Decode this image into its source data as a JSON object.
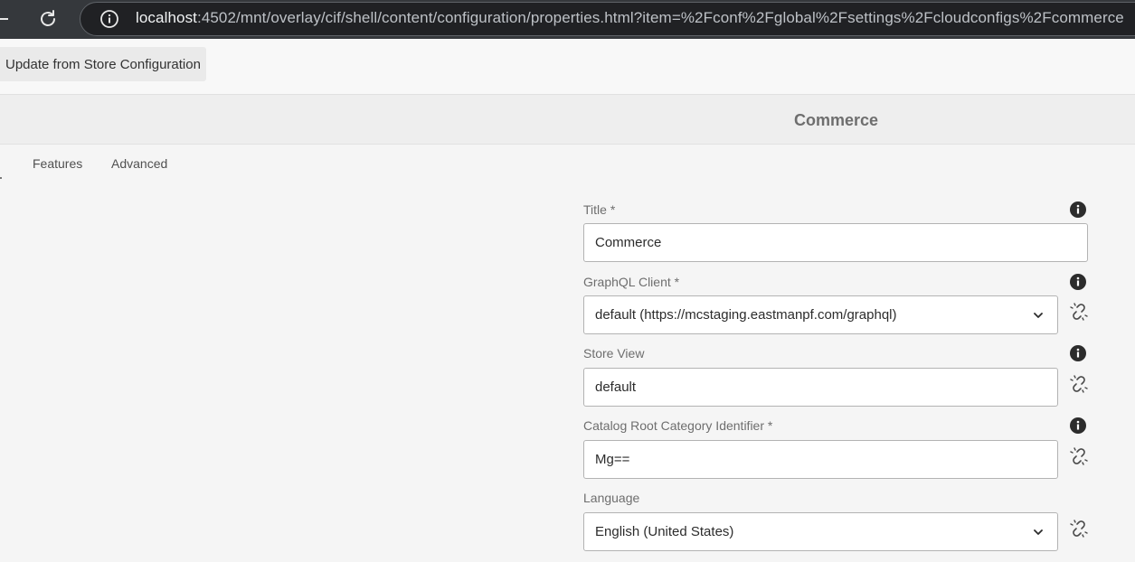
{
  "browser": {
    "url_host": "localhost",
    "url_path": ":4502/mnt/overlay/cif/shell/content/configuration/properties.html?item=%2Fconf%2Fglobal%2Fsettings%2Fcloudconfigs%2Fcommerce"
  },
  "toolbar": {
    "update_label": "Update from Store Configuration"
  },
  "header": {
    "title": "Commerce"
  },
  "tabs": [
    {
      "label": "Features"
    },
    {
      "label": "Advanced"
    }
  ],
  "form": {
    "title": {
      "label": "Title *",
      "value": "Commerce"
    },
    "graphql_client": {
      "label": "GraphQL Client *",
      "value": "default (https://mcstaging.eastmanpf.com/graphql)"
    },
    "store_view": {
      "label": "Store View",
      "value": "default"
    },
    "catalog_root": {
      "label": "Catalog Root Category Identifier *",
      "value": "Mg=="
    },
    "language": {
      "label": "Language",
      "value": "English (United States)"
    }
  },
  "icons": {
    "help": "info-circle-icon",
    "inherit": "broken-link-icon",
    "dropdown": "chevron-down-icon"
  }
}
